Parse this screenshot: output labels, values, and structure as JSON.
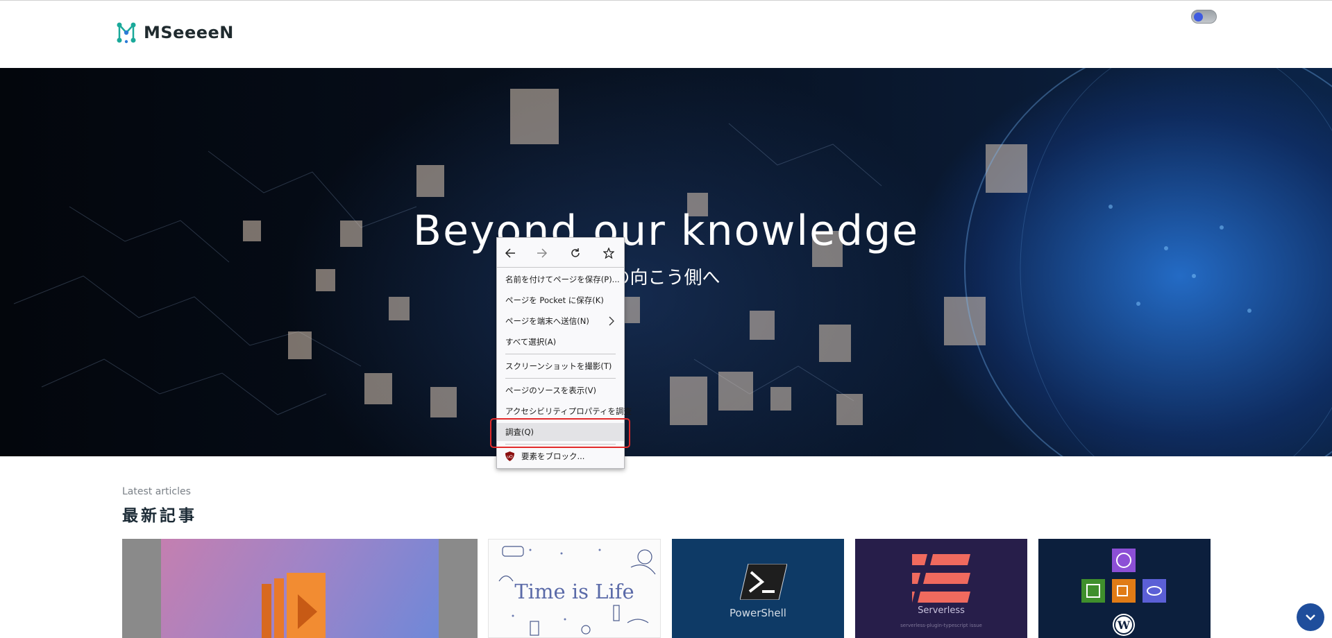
{
  "header": {
    "logo_text": "MSeeeeN",
    "theme_toggle": "theme-toggle"
  },
  "hero": {
    "title": "Beyond our knowledge",
    "subtitle": "の向こう側へ"
  },
  "latest": {
    "kicker": "Latest articles",
    "title": "最新記事"
  },
  "cards": [
    {
      "name": "aws-lambda-card"
    },
    {
      "name": "time-is-life-card",
      "text": "Time is Life"
    },
    {
      "name": "powershell-card",
      "text": "PowerShell"
    },
    {
      "name": "serverless-card",
      "text": "Serverless",
      "sub": "serverless-plugin-typescript issue"
    },
    {
      "name": "aws-wordpress-card"
    }
  ],
  "context_menu": {
    "nav": [
      "back-icon",
      "forward-icon",
      "reload-icon",
      "bookmark-star-icon"
    ],
    "items": [
      {
        "label": "名前を付けてページを保存(P)..."
      },
      {
        "label": "ページを Pocket に保存(K)"
      },
      {
        "label": "ページを端末へ送信(N)",
        "submenu": true
      },
      {
        "label": "すべて選択(A)"
      },
      {
        "label": "スクリーンショットを撮影(T)"
      },
      {
        "label": "ページのソースを表示(V)"
      },
      {
        "label": "アクセシビリティプロパティを調査"
      },
      {
        "label": "調査(Q)",
        "highlighted": true
      },
      {
        "label": "要素をブロック..."
      }
    ]
  },
  "colors": {
    "accent": "#3f5be0",
    "highlight_border": "#e22a2a",
    "scroll_button": "#1f4e9c"
  }
}
